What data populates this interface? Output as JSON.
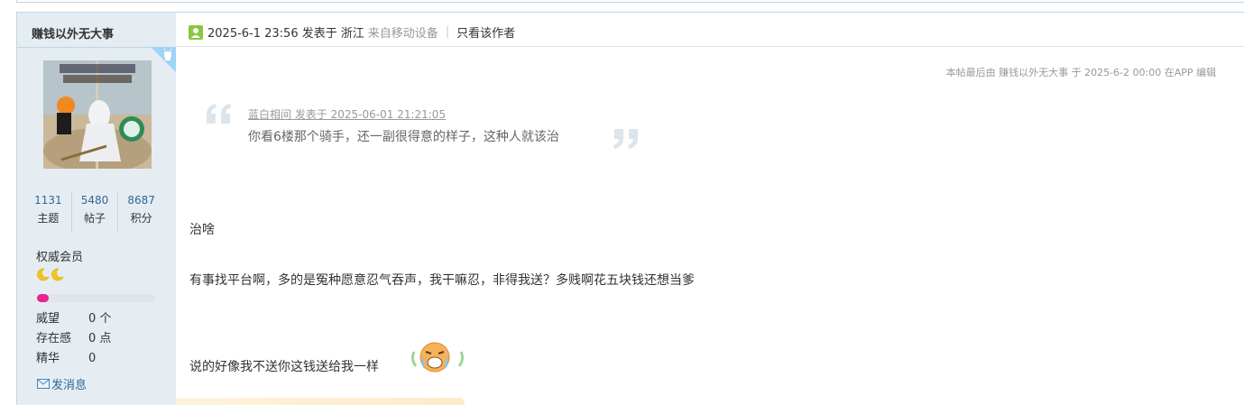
{
  "sidebar": {
    "author_name": "赚钱以外无大事",
    "stats": [
      {
        "value": "1131",
        "label": "主题"
      },
      {
        "value": "5480",
        "label": "帖子"
      },
      {
        "value": "8687",
        "label": "积分"
      }
    ],
    "group": "权威会员",
    "credit_progress": 0.1,
    "info": [
      {
        "label": "威望",
        "value": "0 个"
      },
      {
        "label": "存在感",
        "value": "0 点"
      },
      {
        "label": "精华",
        "value": "0"
      }
    ],
    "send_message": "发消息"
  },
  "post_header": {
    "timestamp": "2025-6-1 23:56 发表于",
    "location": "浙江",
    "device": "来自移动设备",
    "separator": "|",
    "author_only": "只看该作者"
  },
  "post": {
    "edit_note": "本帖最后由 赚钱以外无大事 于 2025-6-2 00:00 在APP 编辑",
    "quote": {
      "meta": "蓝白相间 发表于 2025-06-01 21:21:05",
      "text": "你看6楼那个骑手，还一副很得意的样子，这种人就该治"
    },
    "lines": [
      "治啥",
      "有事找平台啊，多的是冤种愿意忍气吞声，我干嘛忍，非得我送？多贱啊花五块钱还想当爹",
      "说的好像我不送你这钱送给我一样"
    ]
  },
  "colors": {
    "sidebar_bg": "#e5edf2",
    "border": "#c2d5e3",
    "link": "#336699",
    "progress_fill": "#e5258d",
    "quote_mark": "#dbe5ee",
    "android_badge": "#9fd4f3"
  },
  "icons": {
    "android": "android-icon",
    "user": "user-icon",
    "moon": "moon-icon",
    "mail": "mail-icon",
    "smiley": "crying-laugh-smiley"
  }
}
